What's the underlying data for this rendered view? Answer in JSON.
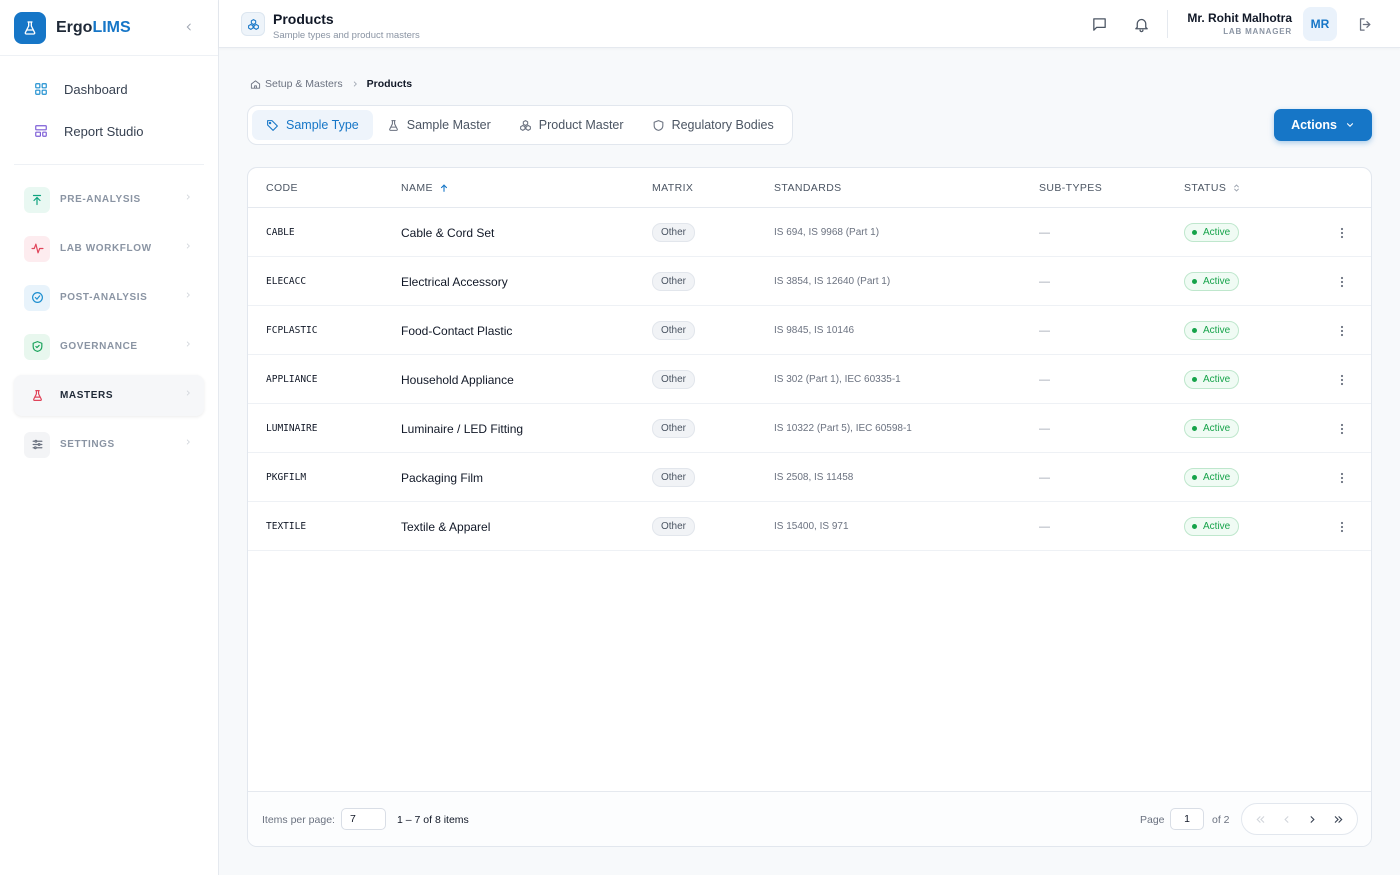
{
  "brand": {
    "name_prefix": "Ergo",
    "name_accent": "LIMS"
  },
  "sidebar": {
    "top_links": [
      {
        "label": "Dashboard",
        "icon": "grid-icon"
      },
      {
        "label": "Report Studio",
        "icon": "layout-icon"
      }
    ],
    "groups": [
      {
        "label": "PRE-ANALYSIS",
        "icon": "arrow-up-icon",
        "color": "#10a37f"
      },
      {
        "label": "LAB WORKFLOW",
        "icon": "activity-icon",
        "color": "#e0445a"
      },
      {
        "label": "POST-ANALYSIS",
        "icon": "check-circle-icon",
        "color": "#1e8fd0"
      },
      {
        "label": "GOVERNANCE",
        "icon": "shield-check-icon",
        "color": "#19a35b"
      },
      {
        "label": "MASTERS",
        "icon": "flask-icon",
        "color": "#e0445a"
      },
      {
        "label": "SETTINGS",
        "icon": "sliders-icon",
        "color": "#6b7280"
      }
    ]
  },
  "header": {
    "title": "Products",
    "subtitle": "Sample types and product masters",
    "user_name": "Mr. Rohit Malhotra",
    "user_role": "LAB MANAGER",
    "avatar_initials": "MR"
  },
  "breadcrumb": {
    "parent": "Setup & Masters",
    "current": "Products"
  },
  "tabs": [
    {
      "label": "Sample Type",
      "icon": "tag-icon"
    },
    {
      "label": "Sample Master",
      "icon": "flask-icon"
    },
    {
      "label": "Product Master",
      "icon": "boxes-icon"
    },
    {
      "label": "Regulatory Bodies",
      "icon": "shield-icon"
    }
  ],
  "actions_label": "Actions",
  "table": {
    "columns": [
      "CODE",
      "NAME",
      "MATRIX",
      "STANDARDS",
      "SUB-TYPES",
      "STATUS"
    ],
    "rows": [
      {
        "code": "CABLE",
        "name": "Cable & Cord Set",
        "matrix": "Other",
        "standards": "IS 694, IS 9968 (Part 1)",
        "subtypes": "—",
        "status": "Active"
      },
      {
        "code": "ELECACC",
        "name": "Electrical Accessory",
        "matrix": "Other",
        "standards": "IS 3854, IS 12640 (Part 1)",
        "subtypes": "—",
        "status": "Active"
      },
      {
        "code": "FCPLASTIC",
        "name": "Food-Contact Plastic",
        "matrix": "Other",
        "standards": "IS 9845, IS 10146",
        "subtypes": "—",
        "status": "Active"
      },
      {
        "code": "APPLIANCE",
        "name": "Household Appliance",
        "matrix": "Other",
        "standards": "IS 302 (Part 1), IEC 60335-1",
        "subtypes": "—",
        "status": "Active"
      },
      {
        "code": "LUMINAIRE",
        "name": "Luminaire / LED Fitting",
        "matrix": "Other",
        "standards": "IS 10322 (Part 5), IEC 60598-1",
        "subtypes": "—",
        "status": "Active"
      },
      {
        "code": "PKGFILM",
        "name": "Packaging Film",
        "matrix": "Other",
        "standards": "IS 2508, IS 11458",
        "subtypes": "—",
        "status": "Active"
      },
      {
        "code": "TEXTILE",
        "name": "Textile & Apparel",
        "matrix": "Other",
        "standards": "IS 15400, IS 971",
        "subtypes": "—",
        "status": "Active"
      }
    ]
  },
  "footer": {
    "items_per_page_label": "Items per page:",
    "items_per_page": "7",
    "range": "1 – 7 of 8 items",
    "page_label": "Page",
    "page": "1",
    "of_pages": "of 2"
  },
  "colors": {
    "accent": "#1676c7",
    "active_status": "#16a34a"
  }
}
